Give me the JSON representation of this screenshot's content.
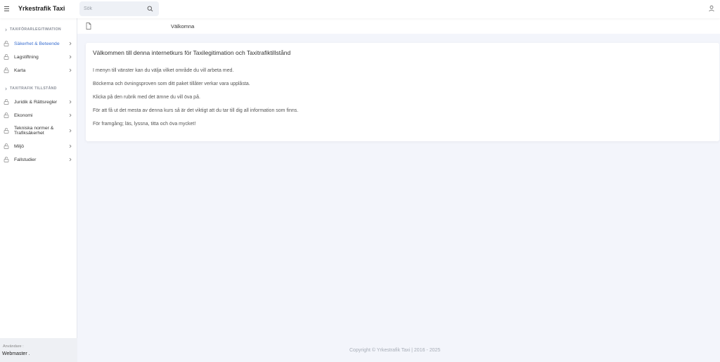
{
  "header": {
    "brand": "Yrkestrafik Taxi",
    "search_placeholder": "Sök"
  },
  "sidebar": {
    "section1": "TAXIFÖRARLEGITIMATION",
    "items1": [
      {
        "label": "Säkerhet & Beteende",
        "active": true
      },
      {
        "label": "Lagstiftning"
      },
      {
        "label": "Karta"
      }
    ],
    "section2": "TAXITRAFIK TILLSTÅND",
    "items2": [
      {
        "label": "Juridik & Rättsregler"
      },
      {
        "label": "Ekonomi"
      },
      {
        "label": "Tekniska normer & Trafiksäkerhet"
      },
      {
        "label": "Miljö"
      },
      {
        "label": "Fallstudier"
      }
    ],
    "user_label": "Användare :",
    "user_name": "Webmaster ."
  },
  "breadcrumb": "Välkomna",
  "card": {
    "title": "Välkommen till denna internetkurs för Taxilegitimation och Taxitrafiktillstånd",
    "paragraphs": [
      "I menyn till vänster kan du välja vilket område du vill arbeta med.",
      "Böckerna och övningsproven som ditt paket tillåter verkar vara upplåsta.",
      "Klicka på den rubrik med det ämne du vill öva på.",
      "För att få ut det mesta av denna kurs så är det viktigt att du tar till dig all information som finns.",
      "För framgång; läs, lyssna, titta och öva mycket!"
    ]
  },
  "footer": "Copyright © Yrkestrafik Taxi | 2016 - 2025",
  "colors": {
    "accent": "#3a6fd0",
    "background": "#f3f5fb"
  }
}
